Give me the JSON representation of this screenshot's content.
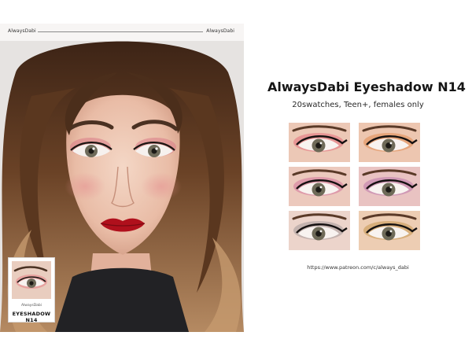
{
  "header": {
    "brand_left": "AlwaysDabi",
    "brand_right": "AlwaysDabi"
  },
  "portrait": {
    "image_alt": "portrait-photo",
    "lip_color": "#b0101c",
    "shadow_color": "#d97a86"
  },
  "badge": {
    "brand": "AlwaysDabi",
    "title": "EYESHADOW N14"
  },
  "product": {
    "title": "AlwaysDabi Eyeshadow N14",
    "subtitle": "20swatches, Teen+, females only"
  },
  "swatches": [
    {
      "color": "#e6858a",
      "skin": "#ecc8b6"
    },
    {
      "color": "#e39a6a",
      "skin": "#edc6b0"
    },
    {
      "color": "#d98aa4",
      "skin": "#ecc9bd"
    },
    {
      "color": "#c78bb0",
      "skin": "#e9c3c2"
    },
    {
      "color": "#b7a8a6",
      "skin": "#ecd4cb"
    },
    {
      "color": "#cfa368",
      "skin": "#edcdb3"
    }
  ],
  "link": {
    "url": "https://www.patreon.com/c/always_dabi"
  }
}
